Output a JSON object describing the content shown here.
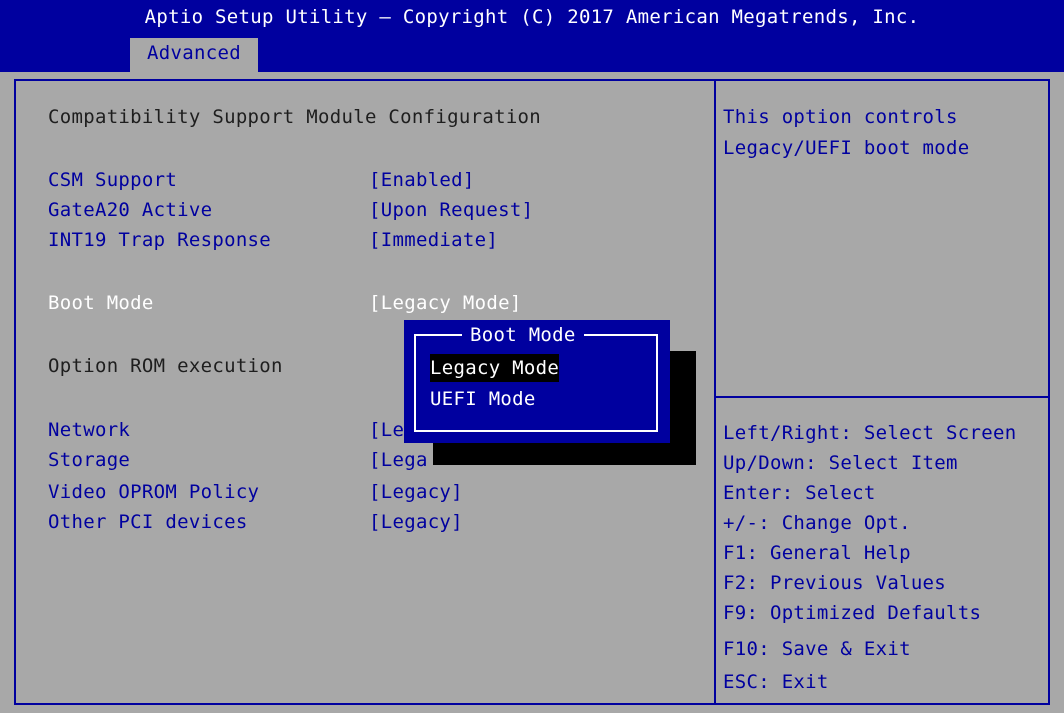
{
  "header": {
    "title": "Aptio Setup Utility – Copyright (C) 2017 American Megatrends, Inc.",
    "tab": "Advanced"
  },
  "main": {
    "heading": "Compatibility Support Module Configuration",
    "settings": [
      {
        "label": "CSM Support",
        "value": "[Enabled]"
      },
      {
        "label": "GateA20 Active",
        "value": "[Upon Request]"
      },
      {
        "label": "INT19 Trap Response",
        "value": "[Immediate]"
      },
      {
        "label": "Boot Mode",
        "value": "[Legacy Mode]"
      },
      {
        "label": "Option ROM execution"
      },
      {
        "label": "Network",
        "value": "[Le"
      },
      {
        "label": "Storage",
        "value": "[Lega"
      },
      {
        "label": "Video OPROM Policy",
        "value": "[Legacy]"
      },
      {
        "label": "Other PCI devices",
        "value": "[Legacy]"
      }
    ]
  },
  "popup": {
    "title": "Boot Mode",
    "options": [
      {
        "label": "Legacy Mode",
        "selected": true
      },
      {
        "label": "UEFI Mode",
        "selected": false
      }
    ]
  },
  "help": {
    "description": [
      "This option controls",
      "Legacy/UEFI boot mode"
    ],
    "keys": [
      "Left/Right: Select Screen",
      "Up/Down: Select Item",
      "Enter: Select",
      "+/-: Change Opt.",
      "F1: General Help",
      "F2: Previous Values",
      "F9: Optimized Defaults",
      "F10: Save & Exit",
      "ESC: Exit"
    ]
  },
  "colors": {
    "header_bg": "#00009f",
    "panel_bg": "#a8a8a8",
    "selectable_text": "#00009f",
    "static_text": "#1e1e1e",
    "highlight_text": "#ffffff"
  }
}
